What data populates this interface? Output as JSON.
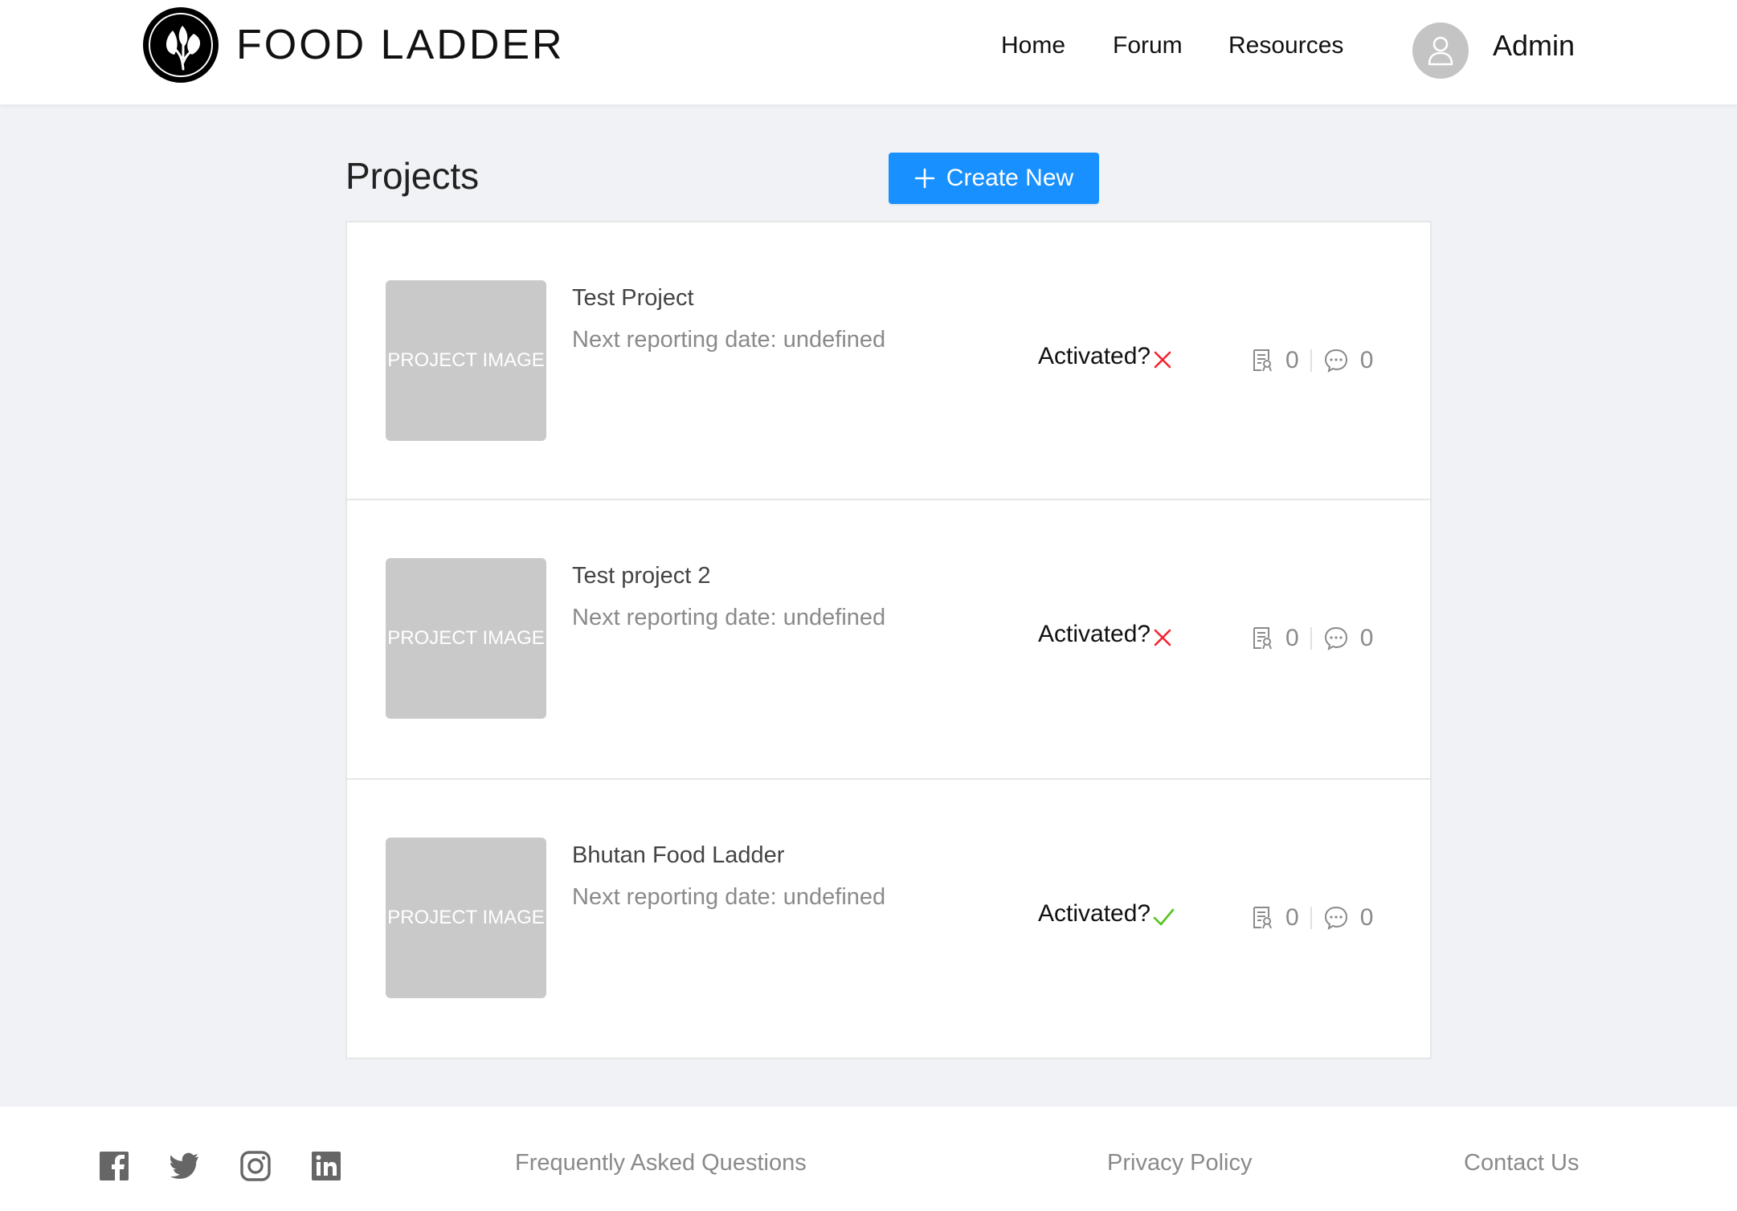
{
  "brand": {
    "name": "FOOD LADDER",
    "logo_icon": "leaf-logo-icon"
  },
  "nav": {
    "items": [
      {
        "label": "Home"
      },
      {
        "label": "Forum"
      },
      {
        "label": "Resources"
      }
    ],
    "user": {
      "name": "Admin",
      "avatar_icon": "user-icon"
    }
  },
  "main": {
    "title": "Projects",
    "create_button": {
      "label": "Create New",
      "icon": "plus-icon"
    },
    "projects": [
      {
        "image_label": "PROJECT IMAGE",
        "name": "Test Project",
        "next_report": "Next reporting date: undefined",
        "activated_label": "Activated?",
        "activated": false,
        "reports_count": "0",
        "comments_count": "0"
      },
      {
        "image_label": "PROJECT IMAGE",
        "name": "Test project 2",
        "next_report": "Next reporting date: undefined",
        "activated_label": "Activated?",
        "activated": false,
        "reports_count": "0",
        "comments_count": "0"
      },
      {
        "image_label": "PROJECT IMAGE",
        "name": "Bhutan Food Ladder",
        "next_report": "Next reporting date: undefined",
        "activated_label": "Activated?",
        "activated": true,
        "reports_count": "0",
        "comments_count": "0"
      }
    ]
  },
  "footer": {
    "social": [
      "facebook-icon",
      "twitter-icon",
      "instagram-icon",
      "linkedin-icon"
    ],
    "links": [
      {
        "label": "Frequently Asked Questions"
      },
      {
        "label": "Privacy Policy"
      },
      {
        "label": "Contact Us"
      }
    ]
  },
  "colors": {
    "primary": "#1890ff",
    "page_bg": "#f0f2f5",
    "inactive": "#f5222d",
    "active": "#52c41a",
    "placeholder": "#c9c9c9"
  }
}
